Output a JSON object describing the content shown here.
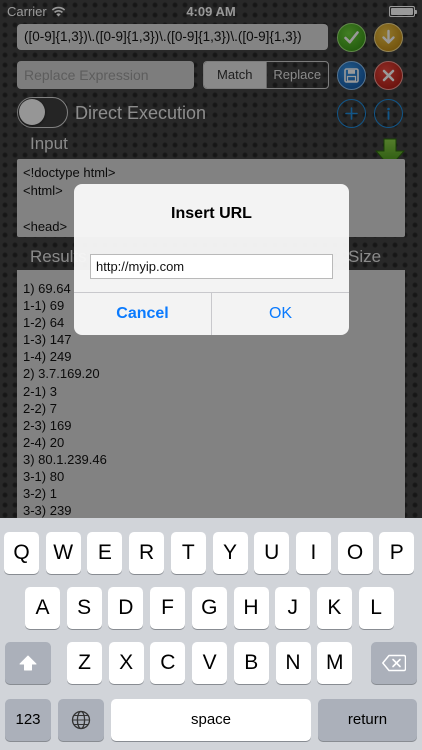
{
  "status_bar": {
    "carrier": "Carrier",
    "time": "4:09 AM"
  },
  "toolbar": {
    "regex": "([0-9]{1,3})\\.([0-9]{1,3})\\.([0-9]{1,3})\\.([0-9]{1,3})",
    "replace_placeholder": "Replace Expression",
    "segment_match": "Match",
    "segment_replace": "Replace",
    "selected_segment": "Replace"
  },
  "options": {
    "direct_execution_label": "Direct Execution",
    "direct_execution_on": false
  },
  "input": {
    "label": "Input",
    "lines": [
      "<!doctype html>",
      "<html>",
      "",
      "<head>"
    ]
  },
  "results": {
    "label": "Results",
    "size_label": "Size",
    "lines": [
      "1) 69.64",
      "1-1) 69",
      "1-2) 64",
      "1-3) 147",
      "1-4) 249",
      "2) 3.7.169.20",
      "2-1) 3",
      "2-2) 7",
      "2-3) 169",
      "2-4) 20",
      "3) 80.1.239.46",
      "3-1) 80",
      "3-2) 1",
      "3-3) 239"
    ]
  },
  "alert": {
    "title": "Insert URL",
    "url_value": "http://myip.com",
    "cancel_label": "Cancel",
    "ok_label": "OK"
  },
  "keyboard": {
    "row1": [
      "Q",
      "W",
      "E",
      "R",
      "T",
      "Y",
      "U",
      "I",
      "O",
      "P"
    ],
    "row2": [
      "A",
      "S",
      "D",
      "F",
      "G",
      "H",
      "J",
      "K",
      "L"
    ],
    "row3": [
      "Z",
      "X",
      "C",
      "V",
      "B",
      "N",
      "M"
    ],
    "numbers_label": "123",
    "space_label": "space",
    "return_label": "return"
  },
  "colors": {
    "accent_blue": "#0a7afe",
    "check_green": "#2d8a0e",
    "download_orange": "#b57d08",
    "save_blue": "#0b4c99",
    "close_red": "#a3140c"
  }
}
